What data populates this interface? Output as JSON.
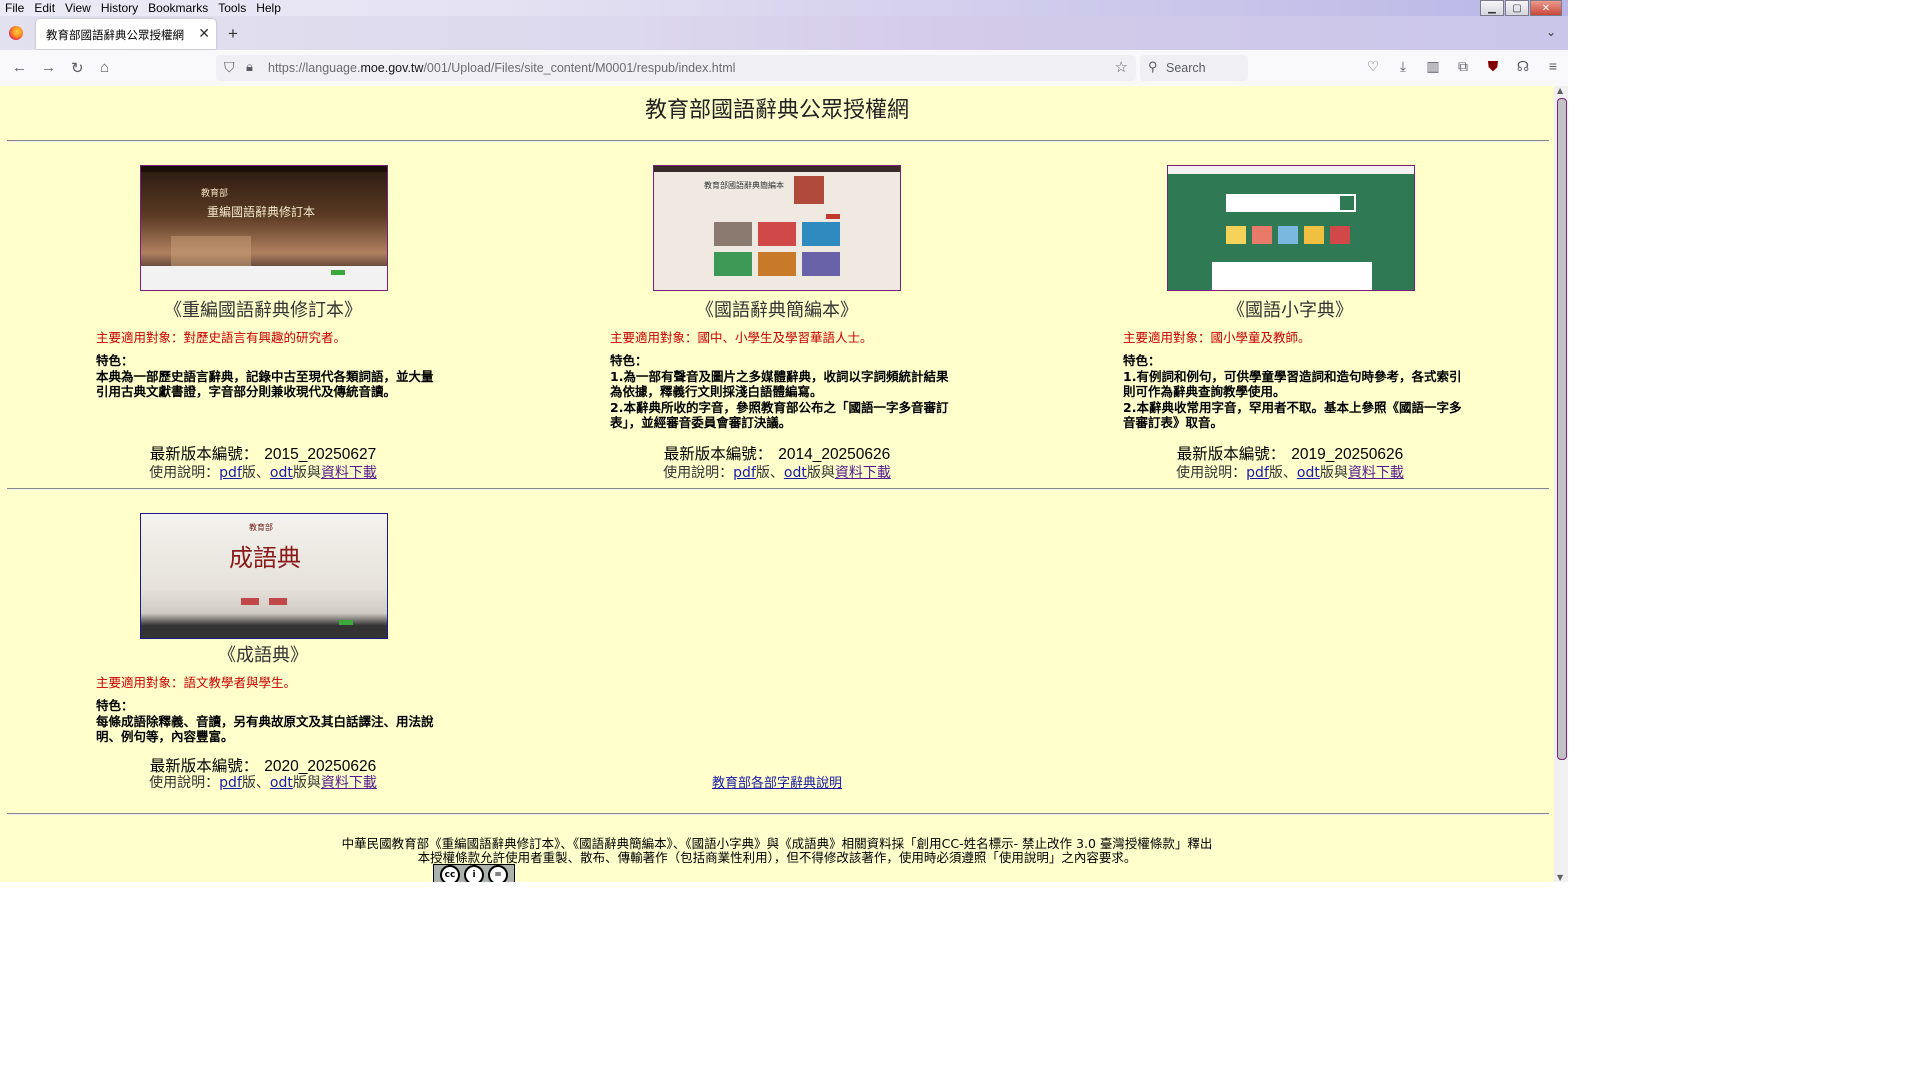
{
  "browser": {
    "menu": [
      "File",
      "Edit",
      "View",
      "History",
      "Bookmarks",
      "Tools",
      "Help"
    ],
    "tab_title": "教育部國語辭典公眾授權網",
    "url_prefix": "https://language.",
    "url_domain": "moe.gov.tw",
    "url_path": "/001/Upload/Files/site_content/M0001/respub/index.html",
    "search_placeholder": "Search"
  },
  "site": {
    "title": "教育部國語辭典公眾授權網"
  },
  "dictionaries": [
    {
      "name": "《重編國語辭典修訂本》",
      "audience": "主要適用對象：對歷史語言有興趣的研究者。",
      "feature_label": "特色：",
      "feature_text": "本典為一部歷史語言辭典，記錄中古至現代各類詞語，並大量引用古典文獻書證，字音部分則兼收現代及傳統音讀。",
      "version_label": "最新版本編號：",
      "version": "2015_20250627",
      "usage_label": "使用說明：",
      "pdf": "pdf",
      "pdf_suffix": "版、",
      "odt": "odt",
      "odt_suffix": "版與",
      "download": "資料下載"
    },
    {
      "name": "《國語辭典簡編本》",
      "audience": "主要適用對象：國中、小學生及學習華語人士。",
      "feature_label": "特色：",
      "feature_text": "1.為一部有聲音及圖片之多媒體辭典，收詞以字詞頻統計結果為依據，釋義行文則採淺白語體編寫。\n2.本辭典所收的字音，參照教育部公布之「國語一字多音審訂表」，並經審音委員會審訂決議。",
      "version_label": "最新版本編號：",
      "version": "2014_20250626",
      "usage_label": "使用說明：",
      "pdf": "pdf",
      "pdf_suffix": "版、",
      "odt": "odt",
      "odt_suffix": "版與",
      "download": "資料下載"
    },
    {
      "name": "《國語小字典》",
      "audience": "主要適用對象：國小學童及教師。",
      "feature_label": "特色：",
      "feature_text": "1.有例詞和例句，可供學童學習造詞和造句時參考，各式索引則可作為辭典查詢教學使用。\n2.本辭典收常用字音，罕用者不取。基本上參照《國語一字多音審訂表》取音。",
      "version_label": "最新版本編號：",
      "version": "2019_20250626",
      "usage_label": "使用說明：",
      "pdf": "pdf",
      "pdf_suffix": "版、",
      "odt": "odt",
      "odt_suffix": "版與",
      "download": "資料下載"
    },
    {
      "name": "《成語典》",
      "audience": "主要適用對象：語文教學者與學生。",
      "feature_label": "特色：",
      "feature_text": "每條成語除釋義、音讀，另有典故原文及其白話譯注、用法說明、例句等，內容豐富。",
      "version_label": "最新版本編號：",
      "version": "2020_20250626",
      "usage_label": "使用說明：",
      "pdf": "pdf",
      "pdf_suffix": "版、",
      "odt": "odt",
      "odt_suffix": "版與",
      "download": "資料下載"
    }
  ],
  "mid_link": "教育部各部字辭典說明",
  "footer": {
    "line1": "中華民國教育部《重編國語辭典修訂本》、《國語辭典簡編本》、《國語小字典》與《成語典》相關資料採「創用CC-姓名標示- 禁止改作 3.0 臺灣授權條款」釋出",
    "line2": "本授權條款允許使用者重製、散布、傳輸著作（包括商業性利用），但不得修改該著作，使用時必須遵照「使用說明」之內容要求。"
  }
}
